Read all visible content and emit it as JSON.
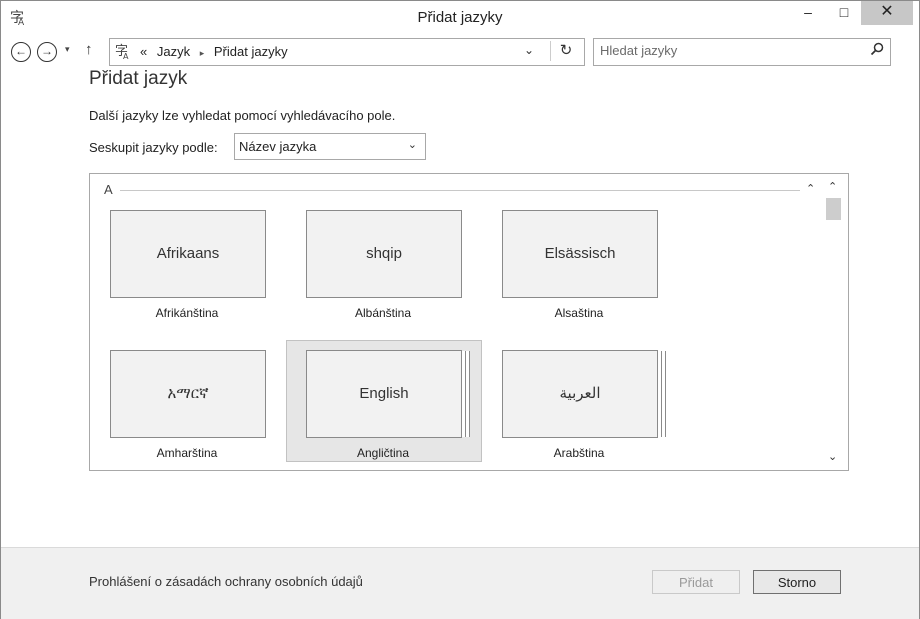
{
  "window": {
    "title": "Přidat jazyky",
    "minimize_glyph": "–",
    "maximize_glyph": "□",
    "close_glyph": "✕"
  },
  "nav": {
    "back_glyph": "←",
    "forward_glyph": "→",
    "recent_glyph": "▾",
    "up_glyph": "↑",
    "address_overflow": "«",
    "breadcrumb": [
      "Jazyk",
      "Přidat jazyky"
    ],
    "breadcrumb_sep": "▸",
    "dropdown_glyph": "⌄",
    "refresh_glyph": "↻",
    "search_placeholder": "Hledat jazyky",
    "search_glyph": "⚲"
  },
  "main": {
    "title": "Přidat jazyk",
    "description": "Další jazyky lze vyhledat pomocí vyhledávacího pole.",
    "group_by_label": "Seskupit jazyky podle:",
    "group_by_value": "Název jazyka",
    "group_by_chevron": "⌄",
    "list": {
      "group_letter": "A",
      "collapse_glyph": "⌃",
      "scroll_up_glyph": "⌃",
      "scroll_down_glyph": "⌄",
      "tiles": [
        {
          "native": "Afrikaans",
          "label": "Afrikánština"
        },
        {
          "native": "shqip",
          "label": "Albánština"
        },
        {
          "native": "Elsässisch",
          "label": "Alsaština"
        },
        {
          "native": "አማርኛ",
          "label": "Amharština"
        },
        {
          "native": "English",
          "label": "Angličtina"
        },
        {
          "native": "العربية",
          "label": "Arabština"
        }
      ]
    }
  },
  "footer": {
    "privacy_link": "Prohlášení o zásadách ochrany osobních údajů",
    "add_button": "Přidat",
    "cancel_button": "Storno"
  }
}
